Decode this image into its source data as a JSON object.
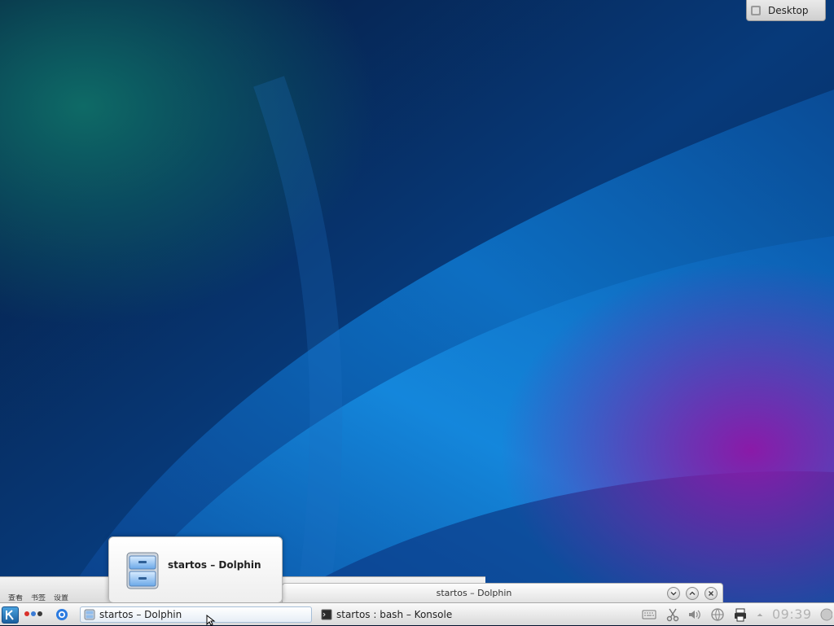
{
  "desktop": {
    "cashew_label": "Desktop",
    "wallpaper_colors": [
      "#04122e",
      "#0b6fc7",
      "#1a8fe0",
      "#6a1a9a",
      "#0c5a5a"
    ]
  },
  "background_window": {
    "menu_items": [
      "",
      "查看",
      "书签",
      "设置"
    ]
  },
  "window_titlebar": {
    "title": "startos – Dolphin"
  },
  "tooltip": {
    "title": "startos – Dolphin",
    "icon": "file-cabinet-icon"
  },
  "taskbar": {
    "tasks": [
      {
        "label": "startos – Dolphin",
        "icon": "dolphin-icon",
        "active": true
      },
      {
        "label": "startos : bash – Konsole",
        "icon": "terminal-icon",
        "active": false
      }
    ],
    "activity_colors": [
      "#d9312b",
      "#3a7bd5",
      "#3a3a3a"
    ],
    "clock": "09:39"
  }
}
